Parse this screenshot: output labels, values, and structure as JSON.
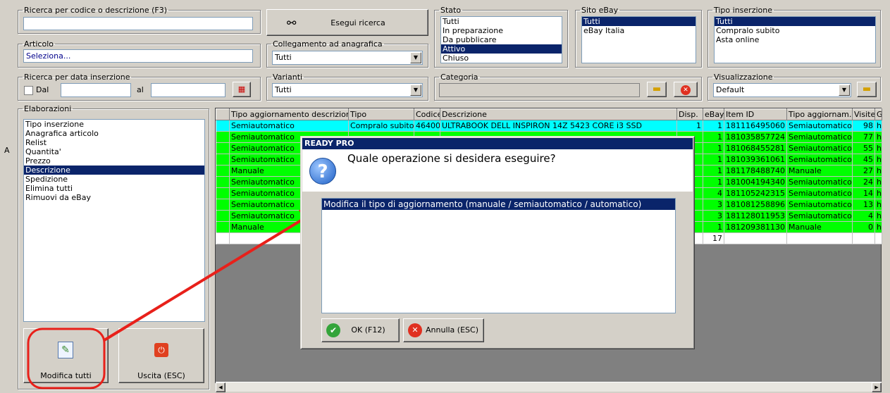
{
  "search": {
    "legend": "Ricerca per codice o descrizione (F3)",
    "value": "",
    "button": "Esegui ricerca"
  },
  "articolo": {
    "legend": "Articolo",
    "value": "Seleziona..."
  },
  "collegamento": {
    "legend": "Collegamento ad anagrafica",
    "value": "Tutti"
  },
  "stato": {
    "legend": "Stato",
    "items": [
      "Tutti",
      "In preparazione",
      "Da pubblicare",
      "Attivo",
      "Chiuso"
    ],
    "selected": 3
  },
  "sito": {
    "legend": "Sito eBay",
    "items": [
      "Tutti",
      "eBay Italia"
    ]
  },
  "tipo_ins": {
    "legend": "Tipo inserzione",
    "items": [
      "Tutti",
      "Compralo subito",
      "Asta online"
    ]
  },
  "data": {
    "legend": "Ricerca per data inserzione",
    "dal": "Dal",
    "al": "al"
  },
  "varianti": {
    "legend": "Varianti",
    "value": "Tutti"
  },
  "categoria": {
    "legend": "Categoria"
  },
  "visualizzazione": {
    "legend": "Visualizzazione",
    "value": "Default"
  },
  "elaborazioni": {
    "legend": "Elaborazioni",
    "items": [
      "Tipo inserzione",
      "Anagrafica articolo",
      "Relist",
      "Quantita'",
      "Prezzo",
      "Descrizione",
      "Spedizione",
      "Elimina tutti",
      "Rimuovi da eBay"
    ],
    "selected": 5
  },
  "side_letter": "A",
  "buttons": {
    "modifica": "Modifica tutti",
    "uscita": "Uscita (ESC)"
  },
  "grid": {
    "headers": [
      "Tipo aggiornamento descrizion...",
      "Tipo",
      "Codice",
      "Descrizione",
      "Disp.",
      "eBay",
      "Item ID",
      "Tipo aggiornam...",
      "Visite",
      "G"
    ],
    "rows": [
      [
        "Semiautomatico",
        "Compralo subito",
        "46400",
        "ULTRABOOK DELL INSPIRON 14Z 5423 CORE i3 SSD",
        "1",
        "1",
        "181116495060",
        "Semiautomatico",
        "98",
        "h"
      ],
      [
        "Semiautomatico",
        "",
        "",
        "",
        "",
        "1",
        "181035857724",
        "Semiautomatico",
        "77",
        "h"
      ],
      [
        "Semiautomatico",
        "",
        "",
        "",
        "",
        "1",
        "181068455281",
        "Semiautomatico",
        "55",
        "h"
      ],
      [
        "Semiautomatico",
        "",
        "",
        "",
        "",
        "1",
        "181039361061",
        "Semiautomatico",
        "45",
        "h"
      ],
      [
        "Manuale",
        "",
        "",
        "",
        "",
        "1",
        "181178488740",
        "Manuale",
        "27",
        "h"
      ],
      [
        "Semiautomatico",
        "",
        "",
        "",
        "",
        "1",
        "181004194340",
        "Semiautomatico",
        "24",
        "h"
      ],
      [
        "Semiautomatico",
        "",
        "",
        "",
        "",
        "4",
        "181105242315",
        "Semiautomatico",
        "14",
        "h"
      ],
      [
        "Semiautomatico",
        "",
        "",
        "",
        "",
        "3",
        "181081258896",
        "Semiautomatico",
        "13",
        "h"
      ],
      [
        "Semiautomatico",
        "",
        "",
        "",
        "",
        "3",
        "181128011953",
        "Semiautomatico",
        "4",
        "h"
      ],
      [
        "Manuale",
        "",
        "",
        "",
        "",
        "1",
        "181209381130",
        "Manuale",
        "0",
        "h"
      ]
    ],
    "total_ebay": "17"
  },
  "dialog": {
    "title": "READY PRO",
    "question": "Quale operazione si desidera eseguire?",
    "options": [
      "Modifica il tipo di aggiornamento (manuale / semiautomatico / automatico)"
    ],
    "ok": "OK (F12)",
    "cancel": "Annulla (ESC)"
  },
  "colors": {
    "selection": "#0a246a",
    "cyan_row": "#00ffff",
    "green_row": "#00ff00",
    "annotation": "#e8201a"
  }
}
